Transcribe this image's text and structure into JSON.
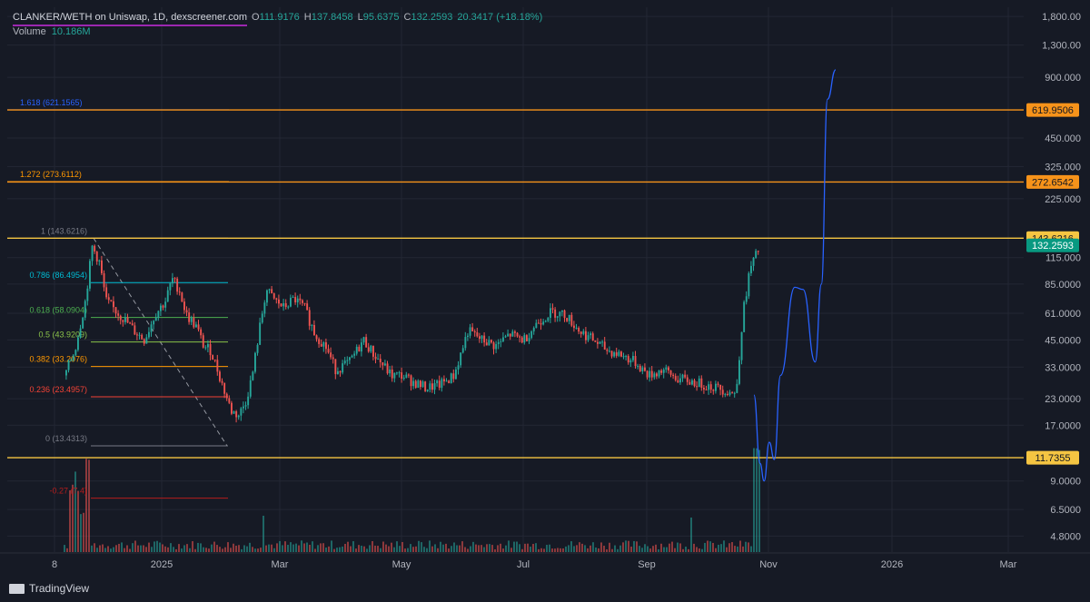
{
  "header": {
    "symbol": "CLANKER/WETH on Uniswap, 1D, dexscreener.com",
    "o_label": "O",
    "o_value": "111.9176",
    "h_label": "H",
    "h_value": "137.8458",
    "l_label": "L",
    "l_value": "95.6375",
    "c_label": "C",
    "c_value": "132.2593",
    "change": "20.3417 (+18.18%)"
  },
  "volume": {
    "label": "Volume",
    "value": "10.186M"
  },
  "footer": {
    "brand": "TradingView"
  },
  "colors": {
    "background": "#161a25",
    "up": "#26a69a",
    "down": "#ef5350",
    "orange": "#f7931a",
    "yellow": "#f5c542",
    "blue": "#2962ff",
    "teal_badge": "#089981"
  },
  "chart_data": {
    "type": "candlestick",
    "title": "CLANKER/WETH on Uniswap, 1D, dexscreener.com",
    "y_scale": "log",
    "ylim": [
      4.0,
      2000
    ],
    "y_ticks": [
      "1,800.00",
      "1,300.00",
      "900.000",
      "450.000",
      "325.000",
      "225.000",
      "115.000",
      "85.0000",
      "61.0000",
      "45.0000",
      "33.0000",
      "23.0000",
      "17.0000",
      "9.0000",
      "6.5000",
      "4.8000"
    ],
    "x_ticks": [
      "8",
      "2025",
      "Mar",
      "May",
      "Jul",
      "Sep",
      "Nov",
      "2026",
      "Mar"
    ],
    "price_badges": [
      {
        "label": "619.9506",
        "value": 619.9506,
        "color": "#f7931a"
      },
      {
        "label": "272.6542",
        "value": 272.6542,
        "color": "#f7931a"
      },
      {
        "label": "143.6216",
        "value": 143.6216,
        "color": "#f5c542"
      },
      {
        "label": "132.2593",
        "value": 132.2593,
        "color": "#089981"
      },
      {
        "label": "11.7355",
        "value": 11.7355,
        "color": "#f5c542"
      }
    ],
    "horizontal_levels": [
      {
        "value": 619.9506,
        "color": "#f7931a"
      },
      {
        "value": 272.6542,
        "color": "#f7931a"
      },
      {
        "value": 143.6216,
        "color": "#f5c542"
      },
      {
        "value": 11.7355,
        "color": "#f5c542"
      }
    ],
    "fib_levels": [
      {
        "label": "1.618 (621.1565)",
        "value": 621.1565,
        "color": "#2962ff"
      },
      {
        "label": "1.272 (273.6112)",
        "value": 273.6112,
        "color": "#ff9800"
      },
      {
        "label": "1 (143.6216)",
        "value": 143.6216,
        "color": "#787b86"
      },
      {
        "label": "0.786 (86.4954)",
        "value": 86.4954,
        "color": "#00bcd4"
      },
      {
        "label": "0.618 (58.0904)",
        "value": 58.0904,
        "color": "#4caf50"
      },
      {
        "label": "0.5 (43.9209)",
        "value": 43.9209,
        "color": "#8bc34a"
      },
      {
        "label": "0.382 (33.2076)",
        "value": 33.2076,
        "color": "#ff9800"
      },
      {
        "label": "0.236 (23.4957)",
        "value": 23.4957,
        "color": "#f44336"
      },
      {
        "label": "0 (13.4313)",
        "value": 13.4313,
        "color": "#787b86"
      },
      {
        "label": "-0.27 (7.4)",
        "value": 7.4,
        "color": "#b71c1c"
      }
    ],
    "price_path": [
      [
        0,
        30
      ],
      [
        0.015,
        40
      ],
      [
        0.03,
        70
      ],
      [
        0.04,
        130
      ],
      [
        0.05,
        110
      ],
      [
        0.06,
        70
      ],
      [
        0.075,
        62
      ],
      [
        0.09,
        55
      ],
      [
        0.1,
        50
      ],
      [
        0.115,
        45
      ],
      [
        0.13,
        60
      ],
      [
        0.145,
        70
      ],
      [
        0.155,
        90
      ],
      [
        0.165,
        80
      ],
      [
        0.175,
        60
      ],
      [
        0.19,
        52
      ],
      [
        0.2,
        42
      ],
      [
        0.21,
        40
      ],
      [
        0.22,
        32
      ],
      [
        0.23,
        25
      ],
      [
        0.24,
        20
      ],
      [
        0.25,
        19
      ],
      [
        0.26,
        22
      ],
      [
        0.27,
        30
      ],
      [
        0.28,
        50
      ],
      [
        0.29,
        80
      ],
      [
        0.3,
        72
      ],
      [
        0.315,
        65
      ],
      [
        0.33,
        72
      ],
      [
        0.345,
        65
      ],
      [
        0.36,
        48
      ],
      [
        0.375,
        42
      ],
      [
        0.39,
        32
      ],
      [
        0.41,
        35
      ],
      [
        0.43,
        45
      ],
      [
        0.445,
        38
      ],
      [
        0.46,
        33
      ],
      [
        0.47,
        30
      ],
      [
        0.485,
        30
      ],
      [
        0.5,
        28
      ],
      [
        0.52,
        26
      ],
      [
        0.54,
        27
      ],
      [
        0.56,
        30
      ],
      [
        0.58,
        50
      ],
      [
        0.6,
        45
      ],
      [
        0.62,
        42
      ],
      [
        0.64,
        48
      ],
      [
        0.66,
        45
      ],
      [
        0.68,
        55
      ],
      [
        0.7,
        62
      ],
      [
        0.72,
        60
      ],
      [
        0.74,
        50
      ],
      [
        0.76,
        45
      ],
      [
        0.78,
        40
      ],
      [
        0.8,
        38
      ],
      [
        0.82,
        35
      ],
      [
        0.84,
        30
      ],
      [
        0.86,
        32
      ],
      [
        0.88,
        29
      ],
      [
        0.9,
        28
      ],
      [
        0.92,
        27
      ],
      [
        0.94,
        26
      ],
      [
        0.955,
        25
      ],
      [
        0.965,
        24
      ],
      [
        0.975,
        60
      ],
      [
        0.985,
        100
      ],
      [
        1,
        132
      ]
    ],
    "projection_path": [
      [
        0,
        24
      ],
      [
        0.03,
        11
      ],
      [
        0.05,
        9
      ],
      [
        0.075,
        14
      ],
      [
        0.1,
        11.5
      ],
      [
        0.13,
        30
      ],
      [
        0.2,
        82
      ],
      [
        0.24,
        80
      ],
      [
        0.3,
        35
      ],
      [
        0.33,
        85
      ],
      [
        0.36,
        700
      ],
      [
        0.4,
        980
      ]
    ]
  }
}
